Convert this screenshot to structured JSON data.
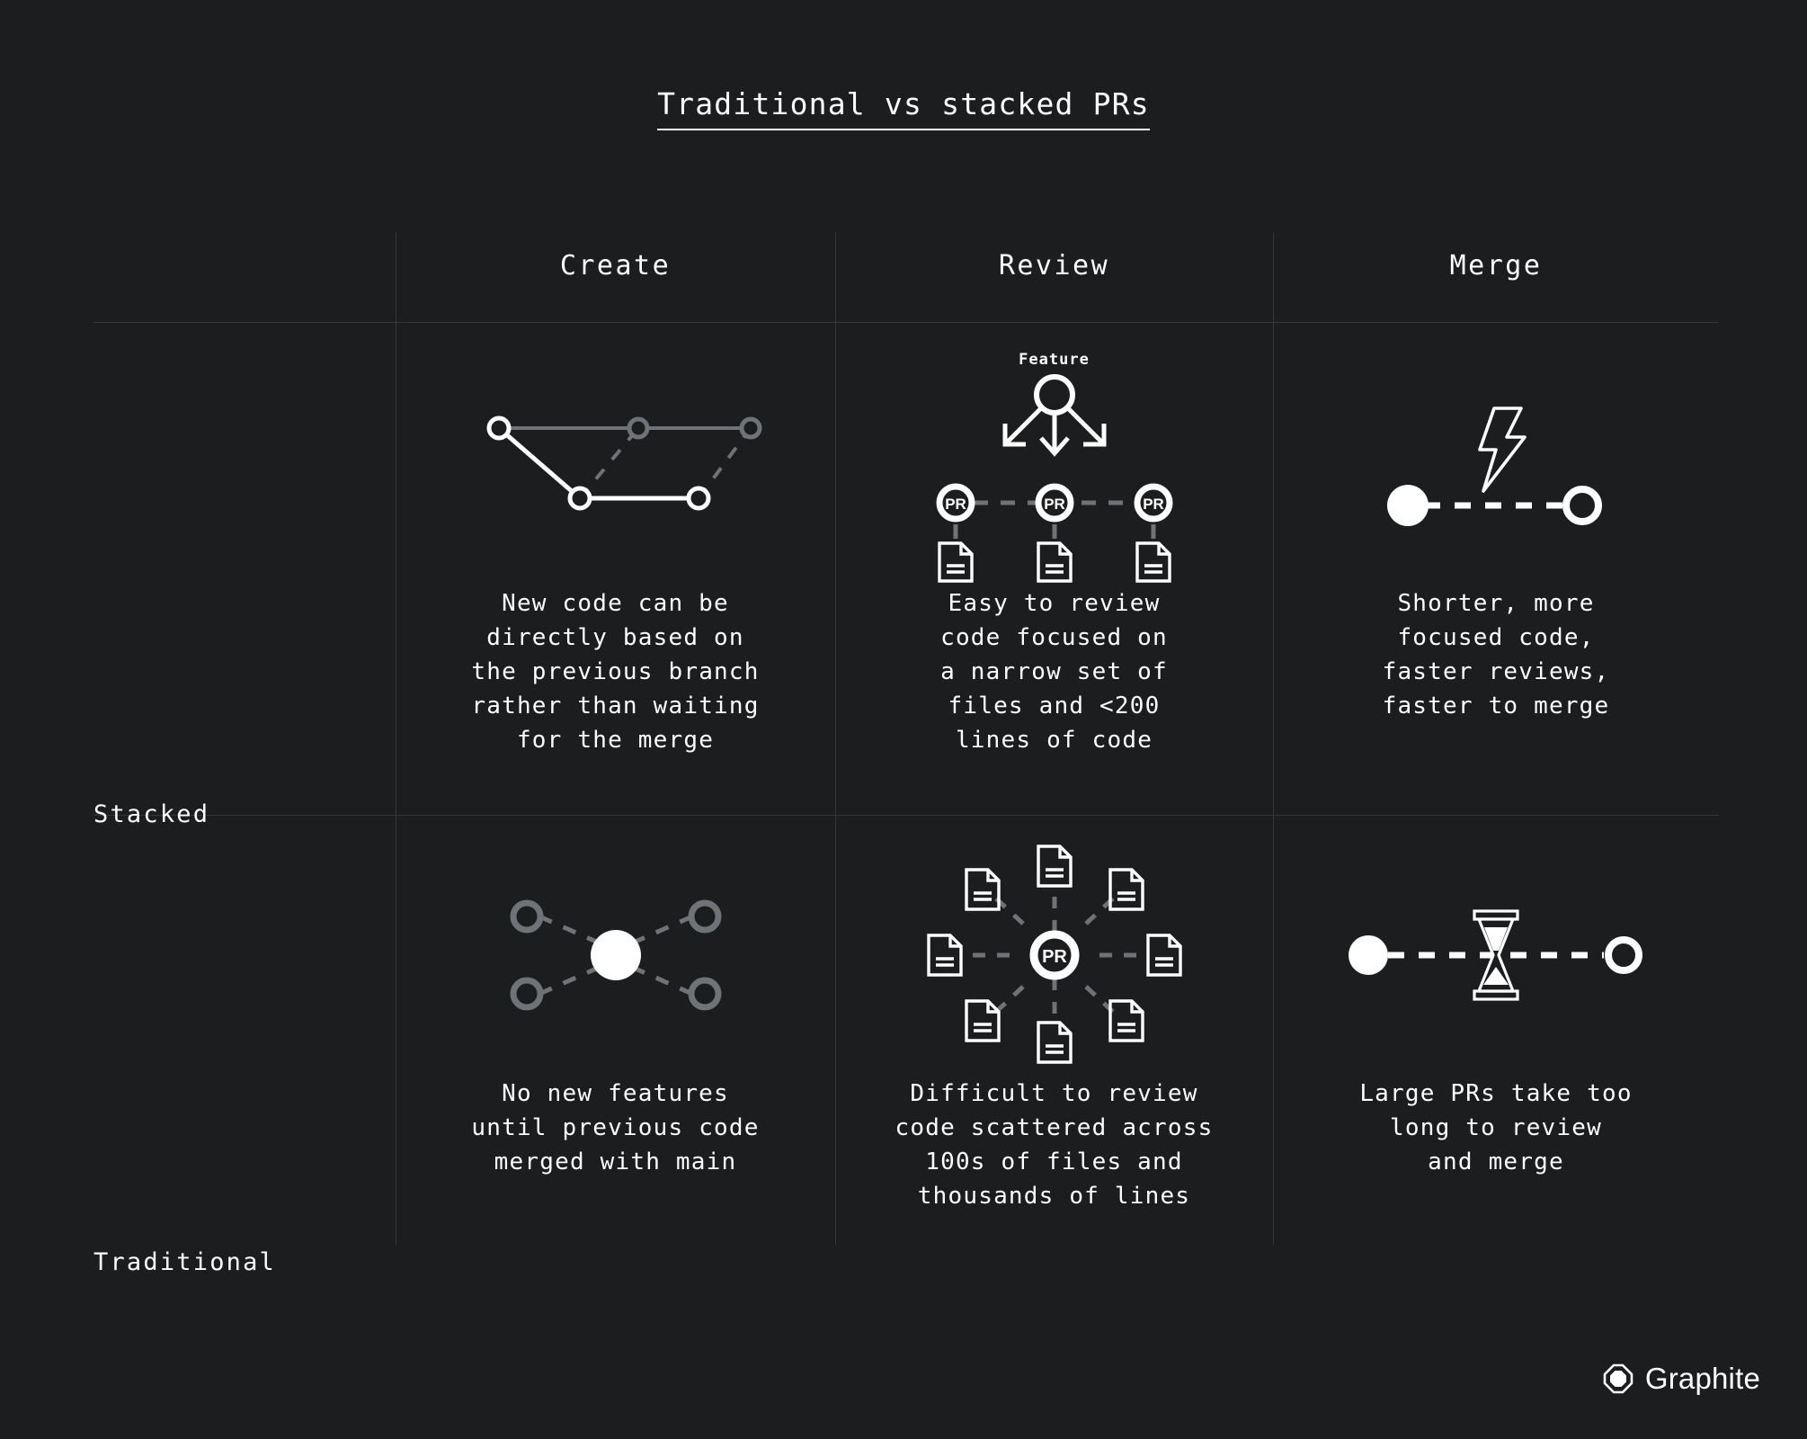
{
  "title": "Traditional vs stacked PRs",
  "columns": [
    {
      "label": "Create"
    },
    {
      "label": "Review"
    },
    {
      "label": "Merge"
    }
  ],
  "rows": [
    {
      "label": "Stacked",
      "cells": [
        {
          "diagram": "stacked-branch-graph",
          "caption": "New code can be\ndirectly based on\nthe previous branch\nrather than waiting\nfor the merge"
        },
        {
          "diagram": "stacked-pr-fanout",
          "feature_label": "Feature",
          "pr_label": "PR",
          "caption": "Easy to review\ncode focused on\na narrow set of\nfiles and <200\nlines of code"
        },
        {
          "diagram": "fast-merge-lightning",
          "caption": "Shorter, more\nfocused code,\nfaster reviews,\nfaster to merge"
        }
      ]
    },
    {
      "label": "Traditional",
      "cells": [
        {
          "diagram": "traditional-star-graph",
          "caption": "No new features\nuntil previous code\nmerged with main"
        },
        {
          "diagram": "traditional-pr-scatter",
          "pr_label": "PR",
          "caption": "Difficult to review\ncode scattered across\n100s of files and\nthousands of lines"
        },
        {
          "diagram": "slow-merge-hourglass",
          "caption": "Large PRs take too\nlong to review\nand merge"
        }
      ]
    }
  ],
  "brand": {
    "name": "Graphite",
    "icon": "graphite-hex-logo"
  },
  "colors": {
    "background": "#1c1d1f",
    "foreground": "#ffffff",
    "muted": "#6f7276",
    "grid_line": "#34363a"
  }
}
